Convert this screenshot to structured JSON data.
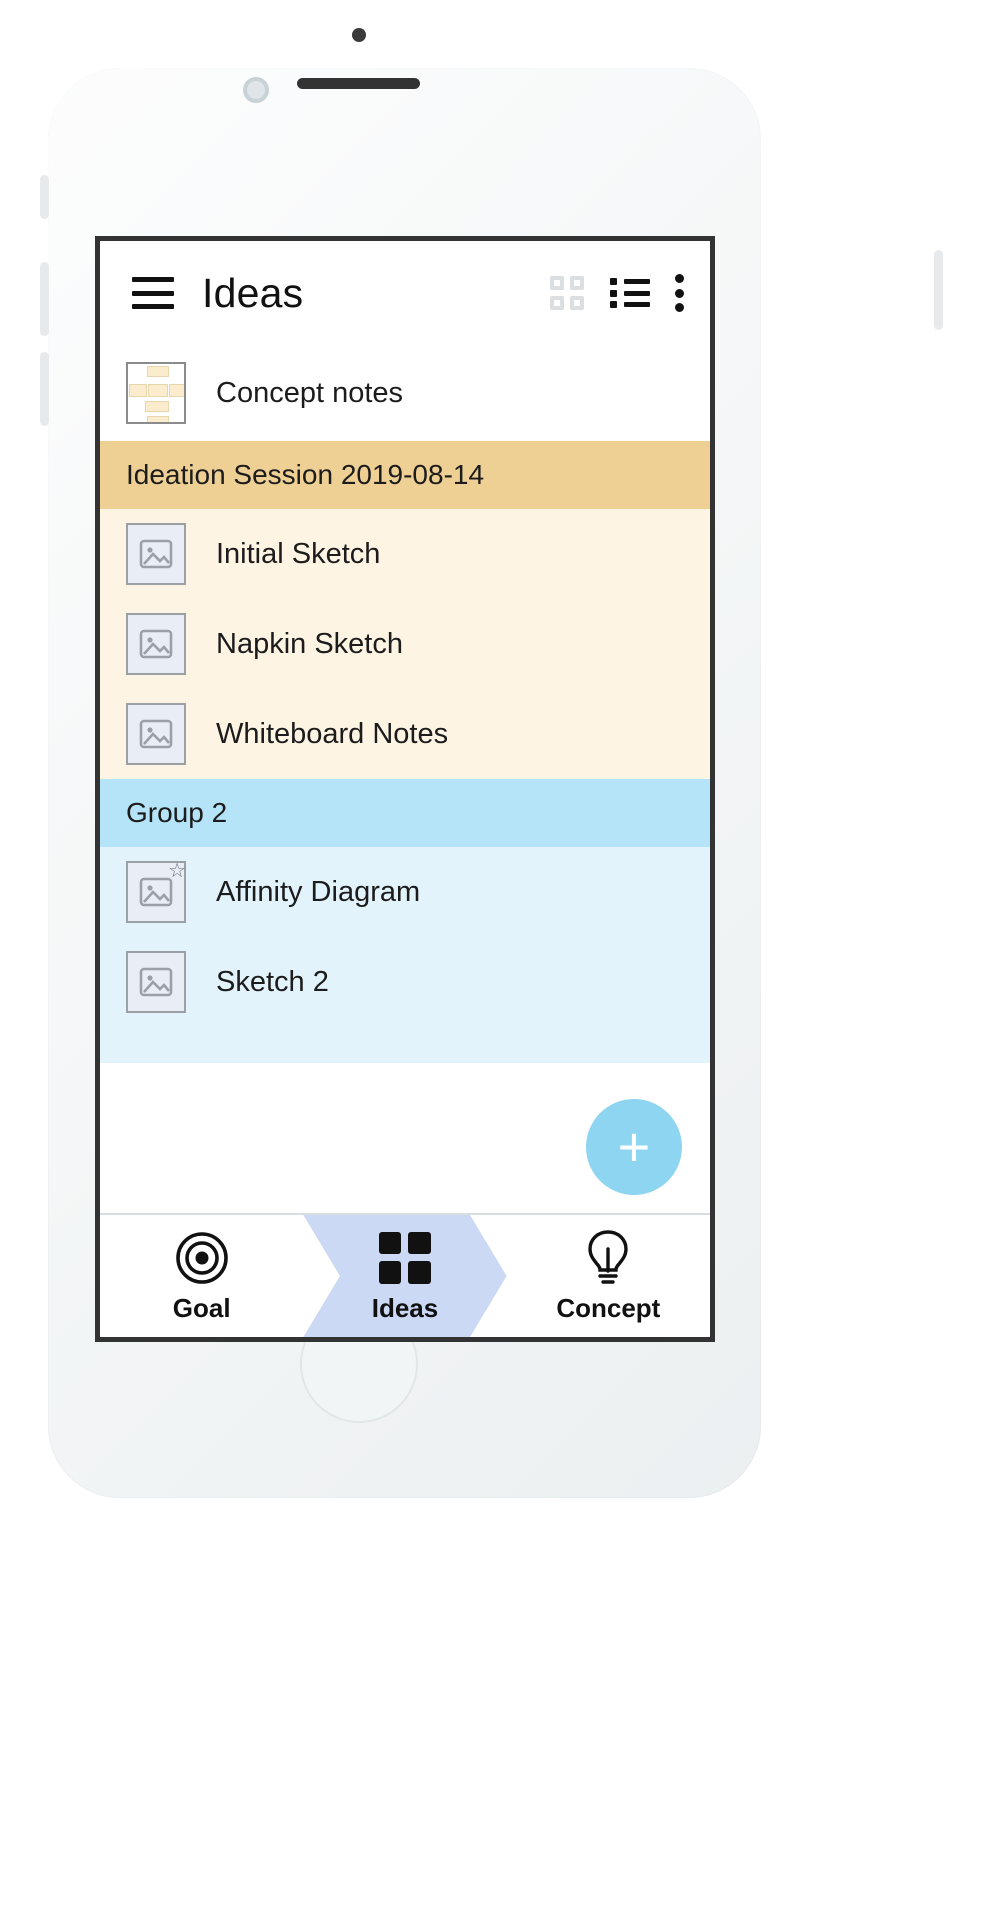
{
  "app": {
    "title": "Ideas"
  },
  "appbar": {
    "menu_icon": "hamburger-menu-icon",
    "grid_view_icon": "grid-view-icon",
    "list_view_icon": "list-view-icon",
    "overflow_icon": "more-vertical-icon"
  },
  "ungrouped": {
    "items": [
      {
        "label": "Concept notes",
        "thumb": "mindmap-thumbnail",
        "starred": false
      }
    ]
  },
  "groups": [
    {
      "name": "Ideation Session 2019-08-14",
      "header_color": "#eecf94",
      "body_color": "#fdf4e4",
      "items": [
        {
          "label": "Initial Sketch",
          "thumb": "image-placeholder-icon",
          "starred": false
        },
        {
          "label": "Napkin Sketch",
          "thumb": "image-placeholder-icon",
          "starred": false
        },
        {
          "label": "Whiteboard Notes",
          "thumb": "image-placeholder-icon",
          "starred": false
        }
      ]
    },
    {
      "name": "Group 2",
      "header_color": "#b5e3f8",
      "body_color": "#e2f3fc",
      "items": [
        {
          "label": "Affinity Diagram",
          "thumb": "image-placeholder-icon",
          "starred": true
        },
        {
          "label": "Sketch 2",
          "thumb": "image-placeholder-icon",
          "starred": false
        }
      ]
    }
  ],
  "fab": {
    "label": "+",
    "color": "#8ed5f2"
  },
  "bottom_nav": {
    "items": [
      {
        "label": "Goal",
        "icon": "target-icon",
        "active": false
      },
      {
        "label": "Ideas",
        "icon": "grid-icon",
        "active": true
      },
      {
        "label": "Concept",
        "icon": "lightbulb-icon",
        "active": false
      }
    ],
    "active_color": "#ccd9f5"
  },
  "colors": {
    "accent": "#8ed5f2",
    "group1_header": "#eecf94",
    "group1_body": "#fdf4e4",
    "group2_header": "#b5e3f8",
    "group2_body": "#e2f3fc",
    "nav_active": "#ccd9f5"
  }
}
